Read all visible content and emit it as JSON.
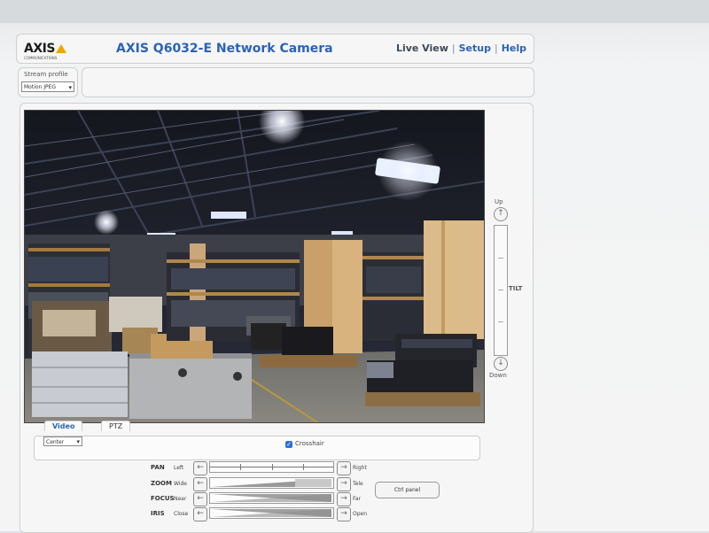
{
  "header": {
    "logo_text": "AXIS",
    "logo_sub": "COMMUNICATIONS",
    "title": "AXIS Q6032-E Network Camera",
    "nav": {
      "live_view": "Live View",
      "setup": "Setup",
      "help": "Help",
      "separator": "|"
    }
  },
  "stream_profile": {
    "label": "Stream profile",
    "value": "Motion JPEG"
  },
  "tilt": {
    "up": "Up",
    "down": "Down",
    "label": "TILT"
  },
  "tabs": {
    "video": "Video",
    "ptz": "PTZ"
  },
  "controls": {
    "preset_value": "Center",
    "crosshair_label": "Crosshair",
    "crosshair_checked": true,
    "ctrl_panel": "Ctrl panel"
  },
  "ptz": [
    {
      "name": "PAN",
      "left": "Left",
      "right": "Right"
    },
    {
      "name": "ZOOM",
      "left": "Wide",
      "right": "Tele"
    },
    {
      "name": "FOCUS",
      "left": "Near",
      "right": "Far"
    },
    {
      "name": "IRIS",
      "left": "Close",
      "right": "Open"
    }
  ],
  "colors": {
    "accent": "#2a63b8",
    "logo_yellow": "#f0a400",
    "checkbox": "#2f6fd6"
  },
  "icons": {
    "up": "arrow-up-icon",
    "down": "arrow-down-icon",
    "left": "arrow-left-icon",
    "right": "arrow-right-icon"
  }
}
